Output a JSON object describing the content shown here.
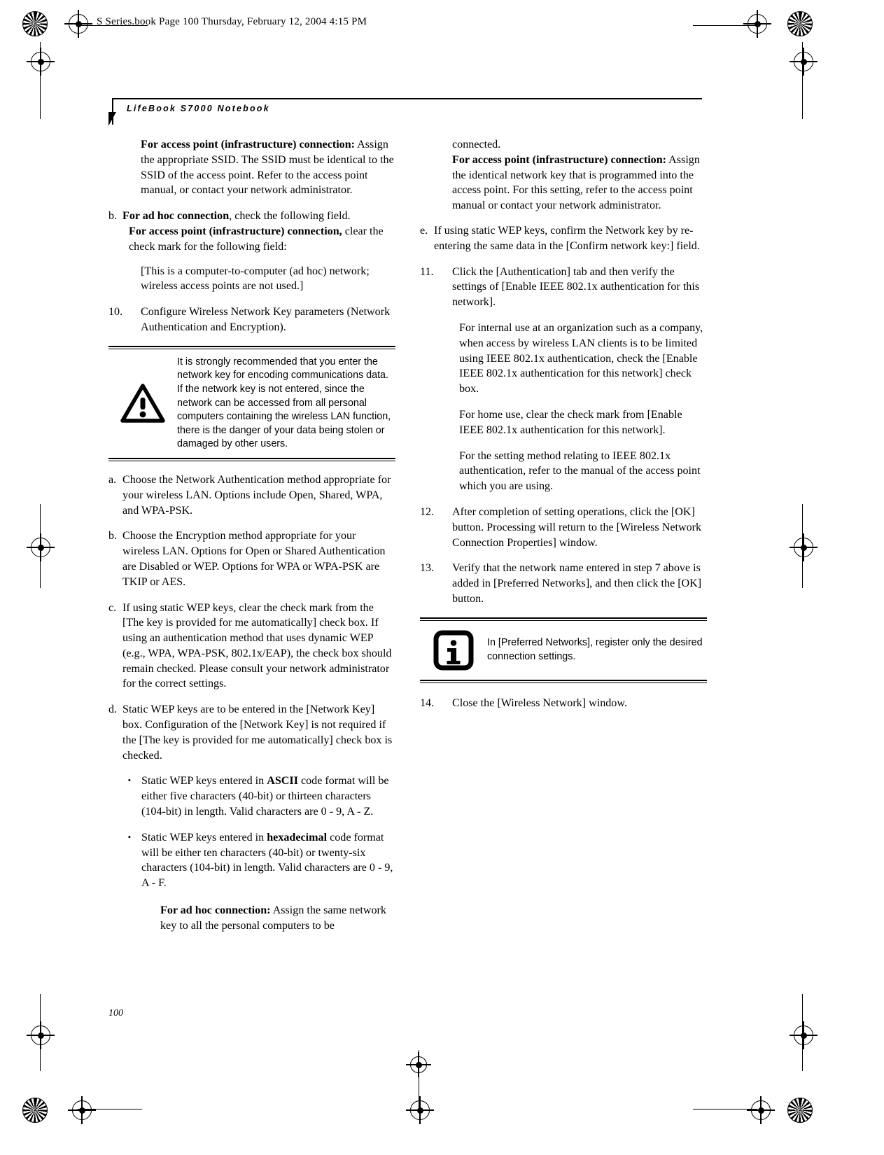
{
  "print_header": "S Series.book  Page 100  Thursday, February 12, 2004  4:15 PM",
  "running_title": "LifeBook S7000 Notebook",
  "page_number": "100",
  "left_column": {
    "ap_heading": "For access point (infrastructure) connection:",
    "ap_body": " Assign the appropriate SSID. The SSID must be identical to the SSID of the access point. Refer to the access point manual, or contact your network administrator.",
    "item_b_marker": "b.",
    "item_b_bold_1": "For ad hoc connection",
    "item_b_rest_1": ", check the following field.",
    "item_b_bold_2": "For access point (infrastructure) connection,",
    "item_b_rest_2": " clear the check mark for the following field:",
    "item_b_note": "[This is a computer-to-computer (ad hoc) network; wireless access points are not used.]",
    "item_10_marker": "10.",
    "item_10_text": "Configure Wireless Network Key parameters (Network Authentication and Encryption).",
    "warning_icon": "warning-triangle-icon",
    "warning_text": "It is strongly recommended that you enter the network key for encoding communications data. If the network key is not entered, since the network can be accessed from all personal computers containing the wireless LAN function, there is the danger of your data being stolen or damaged by other users.",
    "item_a_marker": "a.",
    "item_a_text": "Choose the Network Authentication method appropriate for your wireless LAN. Options include Open, Shared, WPA, and WPA-PSK.",
    "item_b2_marker": "b.",
    "item_b2_text": "Choose the Encryption method appropriate for your wireless LAN. Options for Open or Shared Authentication are Disabled or WEP. Options for WPA or WPA-PSK are TKIP or AES.",
    "item_c_marker": "c.",
    "item_c_text": "If using static WEP keys, clear the check mark from the [The key is provided for me automatically] check box. If using an authentication method that uses dynamic WEP (e.g., WPA, WPA-PSK, 802.1x/EAP), the check box should remain checked. Please consult your network administrator for the correct settings.",
    "item_d_marker": "d.",
    "item_d_text": "Static WEP keys are to be entered in the [Network Key] box. Configuration of the [Network Key] is not required if the [The key is provided for me automatically] check box is checked.",
    "bullet_marker": "▪",
    "bullet_1_pre": "Static WEP keys entered in ",
    "bullet_1_bold": "ASCII",
    "bullet_1_post": " code format will be either five characters (40-bit) or thirteen characters (104-bit) in length. Valid characters are 0 - 9, A - Z.",
    "bullet_2_pre": "Static WEP keys entered in ",
    "bullet_2_bold": "hexadecimal",
    "bullet_2_post": " code format will be either ten characters (40-bit) or twenty-six characters (104-bit) in length. Valid characters are 0 - 9, A - F.",
    "adhoc_bold": "For ad hoc connection:",
    "adhoc_rest": " Assign the same network key to all the personal computers to be"
  },
  "right_column": {
    "continued_word": "connected.",
    "ap_heading": "For access point (infrastructure) connection:",
    "ap_body": " Assign the identical network key that is programmed into the access point. For this setting, refer to the access point manual or contact your network administrator.",
    "item_e_marker": "e.",
    "item_e_text": "If using static WEP keys, confirm the Network key by re-entering the same data in the [Confirm network key:] field.",
    "item_11_marker": "11.",
    "item_11_text": "Click the [Authentication] tab and then verify the settings of [Enable IEEE 802.1x authentication for this network].",
    "item_11_p2": "For internal use at an organization such as a company, when access by wireless LAN clients is to be limited using IEEE 802.1x authentication, check the [Enable IEEE 802.1x authentication for this network] check box.",
    "item_11_p3": "For home use, clear the check mark from [Enable IEEE 802.1x authentication for this network].",
    "item_11_p4": "For the setting method relating to IEEE 802.1x authentication, refer to the manual of the access point which you are using.",
    "item_12_marker": "12.",
    "item_12_text": "After completion of setting operations, click the [OK] button. Processing will return to the [Wireless Network Connection Properties] window.",
    "item_13_marker": "13.",
    "item_13_text": "Verify that the network name entered in step 7 above is added in [Preferred Networks], and then click the [OK] button.",
    "info_icon": "information-i-icon",
    "info_text": "In [Preferred Networks], register only the desired connection settings.",
    "item_14_marker": "14.",
    "item_14_text": "Close the [Wireless Network] window."
  }
}
